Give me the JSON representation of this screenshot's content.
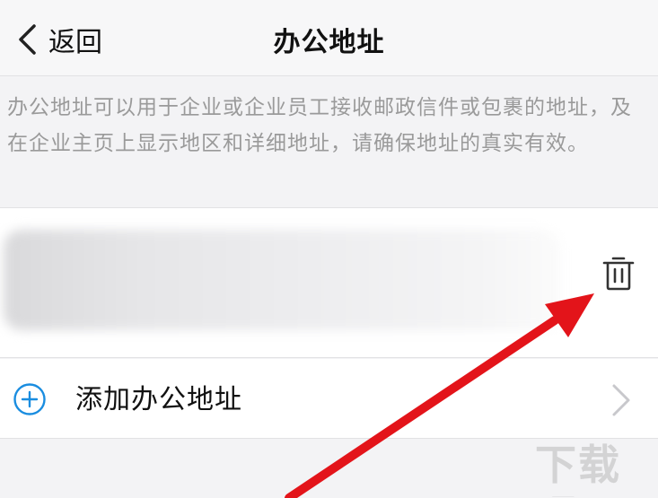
{
  "nav": {
    "back_label": "返回",
    "title": "办公地址"
  },
  "description": "办公地址可以用于企业或企业员工接收邮政信件或包裹的地址，及在企业主页上显示地区和详细地址，请确保地址的真实有效。",
  "address_row": {
    "delete_icon": "trash-icon"
  },
  "add_row": {
    "label": "添加办公地址",
    "icon": "plus-circle-icon",
    "chevron": "chevron-right-icon"
  },
  "watermark": "下载吧",
  "colors": {
    "accent": "#1a8de0",
    "arrow": "#e3141a",
    "description": "#9a9a9a",
    "background": "#f3f3f5"
  }
}
